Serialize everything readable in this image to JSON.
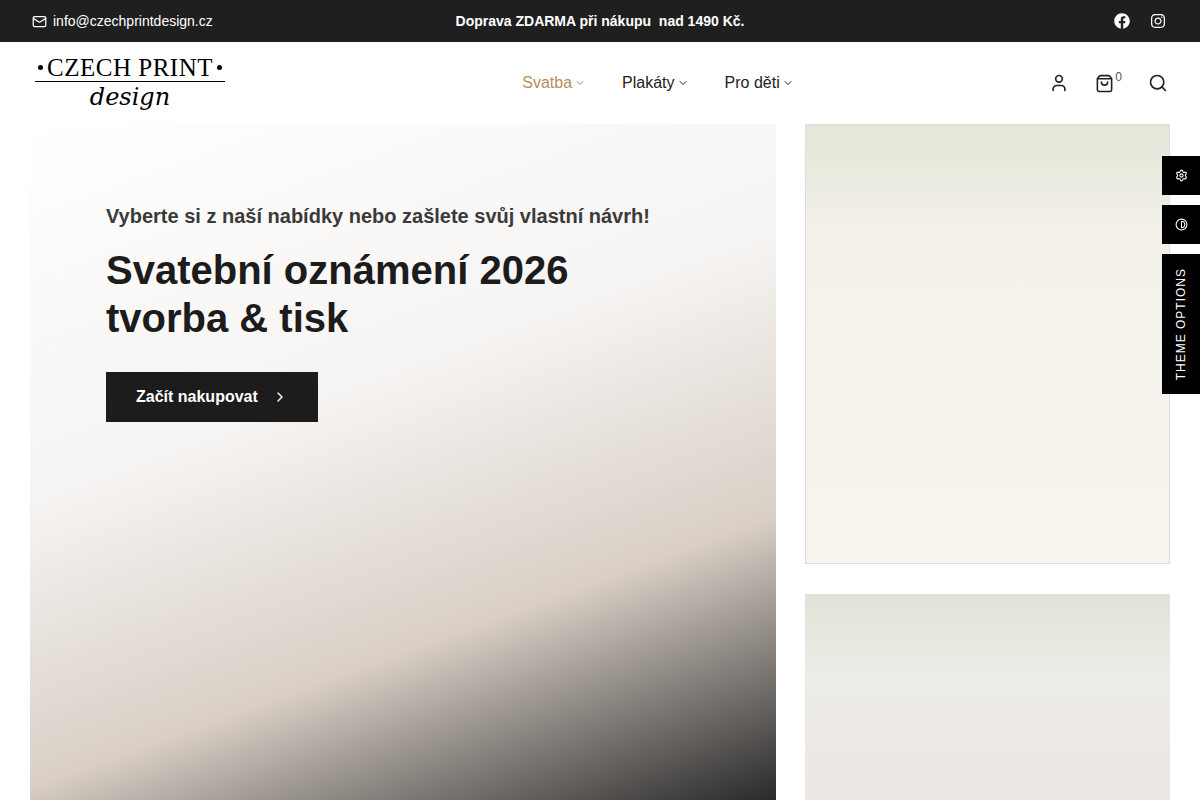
{
  "topbar": {
    "email": "info@czechprintdesign.cz",
    "promo": "Doprava ZDARMA při nákupu  nad 1490 Kč."
  },
  "logo": {
    "title": "CZECH PRINT",
    "subtitle": "design"
  },
  "nav": [
    {
      "label": "Svatba",
      "selected": true
    },
    {
      "label": "Plakáty",
      "selected": false
    },
    {
      "label": "Pro děti",
      "selected": false
    }
  ],
  "cart": {
    "count": "0"
  },
  "hero": {
    "subtitle": "Vyberte si z naší nabídky nebo zašlete svůj vlastní návrh!",
    "title_lines": [
      "Svatební oznámení 2026",
      "tvorba & tisk"
    ],
    "button": "Začít nakupovat"
  },
  "theme_options": {
    "label": "THEME OPTIONS"
  }
}
